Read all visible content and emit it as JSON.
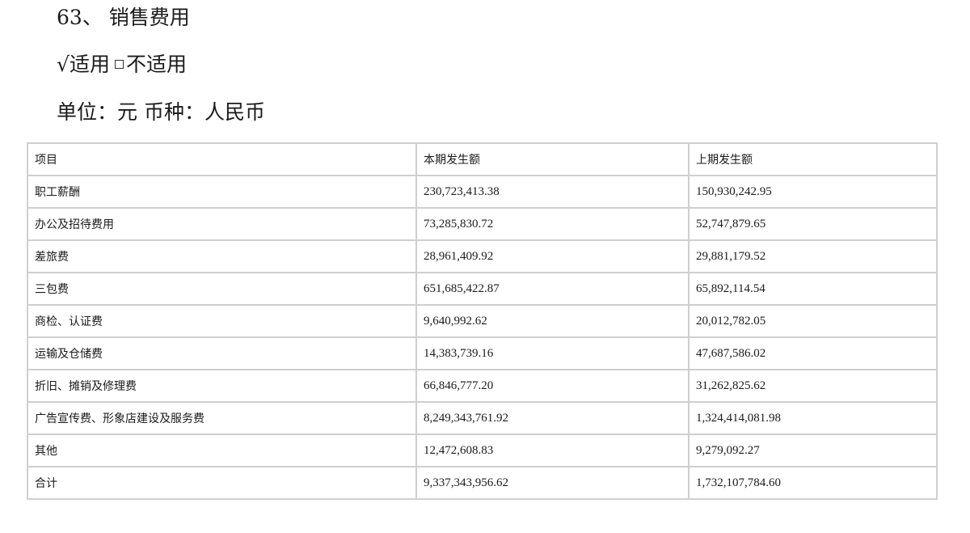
{
  "section": {
    "number": "63",
    "separator": "、",
    "title": "销售费用"
  },
  "applicability": {
    "checked_mark": "√",
    "applicable": "适用",
    "not_applicable": "不适用"
  },
  "unit_line": "单位：元 币种：人民币",
  "table": {
    "headers": [
      "项目",
      "本期发生额",
      "上期发生额"
    ],
    "rows": [
      [
        "职工薪酬",
        "230,723,413.38",
        "150,930,242.95"
      ],
      [
        "办公及招待费用",
        "73,285,830.72",
        "52,747,879.65"
      ],
      [
        "差旅费",
        "28,961,409.92",
        "29,881,179.52"
      ],
      [
        "三包费",
        "651,685,422.87",
        "65,892,114.54"
      ],
      [
        "商检、认证费",
        "9,640,992.62",
        "20,012,782.05"
      ],
      [
        "运输及仓储费",
        "14,383,739.16",
        "47,687,586.02"
      ],
      [
        "折旧、摊销及修理费",
        "66,846,777.20",
        "31,262,825.62"
      ],
      [
        "广告宣传费、形象店建设及服务费",
        "8,249,343,761.92",
        "1,324,414,081.98"
      ],
      [
        "其他",
        "12,472,608.83",
        "9,279,092.27"
      ],
      [
        "合计",
        "9,337,343,956.62",
        "1,732,107,784.60"
      ]
    ]
  }
}
